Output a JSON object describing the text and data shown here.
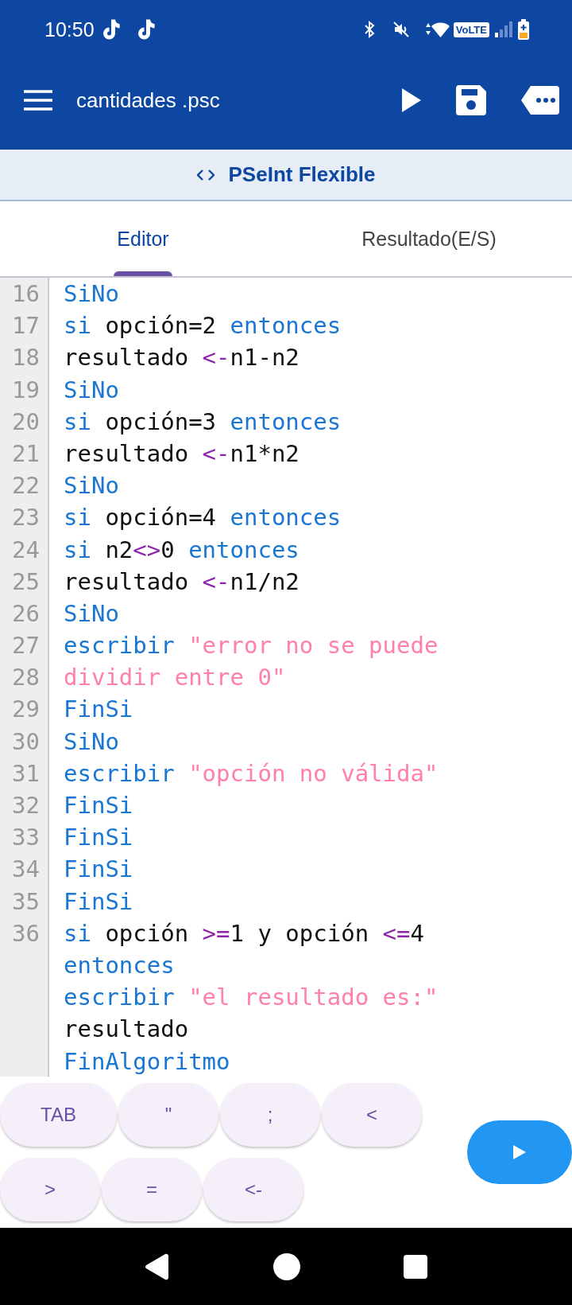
{
  "status_bar": {
    "time": "10:50",
    "network_badge": "VoLTE"
  },
  "app_bar": {
    "title": "cantidades .psc"
  },
  "subtitle": "PSeInt Flexible",
  "tabs": [
    {
      "label": "Editor",
      "selected": true
    },
    {
      "label": "Resultado(E/S)",
      "selected": false
    }
  ],
  "editor": {
    "lines": [
      {
        "number": "16",
        "tokens": [
          {
            "kind": "kw",
            "text": "SiNo"
          }
        ]
      },
      {
        "number": "17",
        "tokens": [
          {
            "kind": "kw",
            "text": "si "
          },
          {
            "kind": "id",
            "text": "opción=2 "
          },
          {
            "kind": "kw",
            "text": "entonces"
          }
        ]
      },
      {
        "number": "18",
        "tokens": [
          {
            "kind": "id",
            "text": "resultado "
          },
          {
            "kind": "op",
            "text": "<-"
          },
          {
            "kind": "id",
            "text": "n1-n2"
          }
        ]
      },
      {
        "number": "19",
        "tokens": [
          {
            "kind": "kw",
            "text": "SiNo"
          }
        ]
      },
      {
        "number": "20",
        "tokens": [
          {
            "kind": "kw",
            "text": "si "
          },
          {
            "kind": "id",
            "text": "opción=3 "
          },
          {
            "kind": "kw",
            "text": "entonces"
          }
        ]
      },
      {
        "number": "21",
        "tokens": [
          {
            "kind": "id",
            "text": "resultado "
          },
          {
            "kind": "op",
            "text": "<-"
          },
          {
            "kind": "id",
            "text": "n1*n2"
          }
        ]
      },
      {
        "number": "22",
        "tokens": [
          {
            "kind": "kw",
            "text": "SiNo"
          }
        ]
      },
      {
        "number": "23",
        "tokens": [
          {
            "kind": "kw",
            "text": "si "
          },
          {
            "kind": "id",
            "text": "opción=4 "
          },
          {
            "kind": "kw",
            "text": "entonces"
          }
        ]
      },
      {
        "number": "24",
        "tokens": [
          {
            "kind": "kw",
            "text": "si "
          },
          {
            "kind": "id",
            "text": "n2"
          },
          {
            "kind": "op",
            "text": "<>"
          },
          {
            "kind": "id",
            "text": "0 "
          },
          {
            "kind": "kw",
            "text": "entonces"
          }
        ]
      },
      {
        "number": "25",
        "tokens": [
          {
            "kind": "id",
            "text": "resultado "
          },
          {
            "kind": "op",
            "text": "<-"
          },
          {
            "kind": "id",
            "text": "n1/n2"
          }
        ]
      },
      {
        "number": "26",
        "tokens": [
          {
            "kind": "kw",
            "text": "SiNo"
          }
        ]
      },
      {
        "number": "27",
        "tokens": [
          {
            "kind": "kw",
            "text": "escribir "
          },
          {
            "kind": "str",
            "text": "\"error no se puede"
          }
        ]
      },
      {
        "number": "28",
        "tokens": [
          {
            "kind": "str",
            "text": "dividir entre 0\""
          }
        ]
      },
      {
        "number": "29",
        "tokens": [
          {
            "kind": "kw",
            "text": "FinSi"
          }
        ]
      },
      {
        "number": "30",
        "tokens": [
          {
            "kind": "kw",
            "text": "SiNo"
          }
        ]
      },
      {
        "number": "31",
        "tokens": [
          {
            "kind": "kw",
            "text": "escribir "
          },
          {
            "kind": "str",
            "text": "\"opción no válida\""
          }
        ]
      },
      {
        "number": "32",
        "tokens": [
          {
            "kind": "kw",
            "text": "FinSi"
          }
        ]
      },
      {
        "number": "33",
        "tokens": [
          {
            "kind": "kw",
            "text": "FinSi"
          }
        ]
      },
      {
        "number": "34",
        "tokens": [
          {
            "kind": "kw",
            "text": "FinSi"
          }
        ]
      },
      {
        "number": "35",
        "tokens": [
          {
            "kind": "kw",
            "text": "FinSi"
          }
        ]
      },
      {
        "number": "36",
        "tokens": [
          {
            "kind": "kw",
            "text": "si "
          },
          {
            "kind": "id",
            "text": "opción "
          },
          {
            "kind": "op",
            "text": ">="
          },
          {
            "kind": "id",
            "text": "1 y opción "
          },
          {
            "kind": "op",
            "text": "<="
          },
          {
            "kind": "id",
            "text": "4"
          }
        ]
      },
      {
        "tokens": [
          {
            "kind": "kw",
            "text": "entonces"
          }
        ]
      },
      {
        "tokens": [
          {
            "kind": "kw",
            "text": "escribir "
          },
          {
            "kind": "str",
            "text": "\"el resultado es:\""
          }
        ]
      },
      {
        "tokens": [
          {
            "kind": "id",
            "text": "resultado"
          }
        ]
      },
      {
        "tokens": [
          {
            "kind": "kw",
            "text": "FinAlgoritmo"
          }
        ]
      }
    ]
  },
  "keys": [
    [
      "TAB",
      "\"",
      ";",
      "<"
    ],
    [
      ">",
      "=",
      "<-"
    ]
  ]
}
